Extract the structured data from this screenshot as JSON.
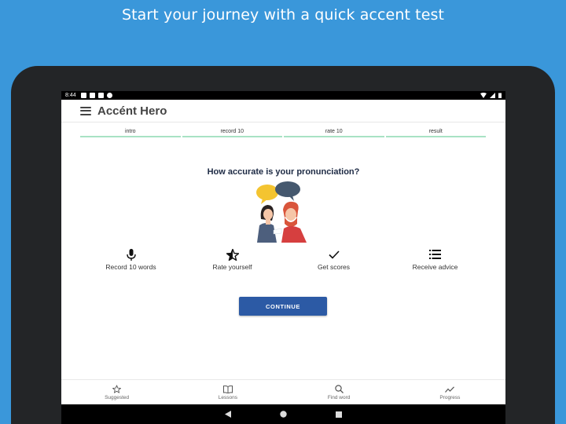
{
  "headline": "Start your journey with a quick accent test",
  "status": {
    "time": "8:44"
  },
  "app": {
    "title": "Accént Hero"
  },
  "steps": [
    {
      "label": "intro"
    },
    {
      "label": "record 10"
    },
    {
      "label": "rate 10"
    },
    {
      "label": "result"
    }
  ],
  "question": "How accurate is your pronunciation?",
  "features": [
    {
      "label": "Record 10 words",
      "icon": "microphone-icon"
    },
    {
      "label": "Rate yourself",
      "icon": "star-half-icon"
    },
    {
      "label": "Get scores",
      "icon": "checkmark-icon"
    },
    {
      "label": "Receive advice",
      "icon": "list-icon"
    }
  ],
  "continue_label": "CONTINUE",
  "bottom_nav": [
    {
      "label": "Suggested",
      "icon": "star-outline-icon"
    },
    {
      "label": "Lessons",
      "icon": "book-icon"
    },
    {
      "label": "Find word",
      "icon": "search-icon"
    },
    {
      "label": "Progress",
      "icon": "trending-icon"
    }
  ],
  "colors": {
    "background": "#3a97da",
    "primary_button": "#2c5aa5",
    "step_indicator": "#a8e2c4"
  }
}
